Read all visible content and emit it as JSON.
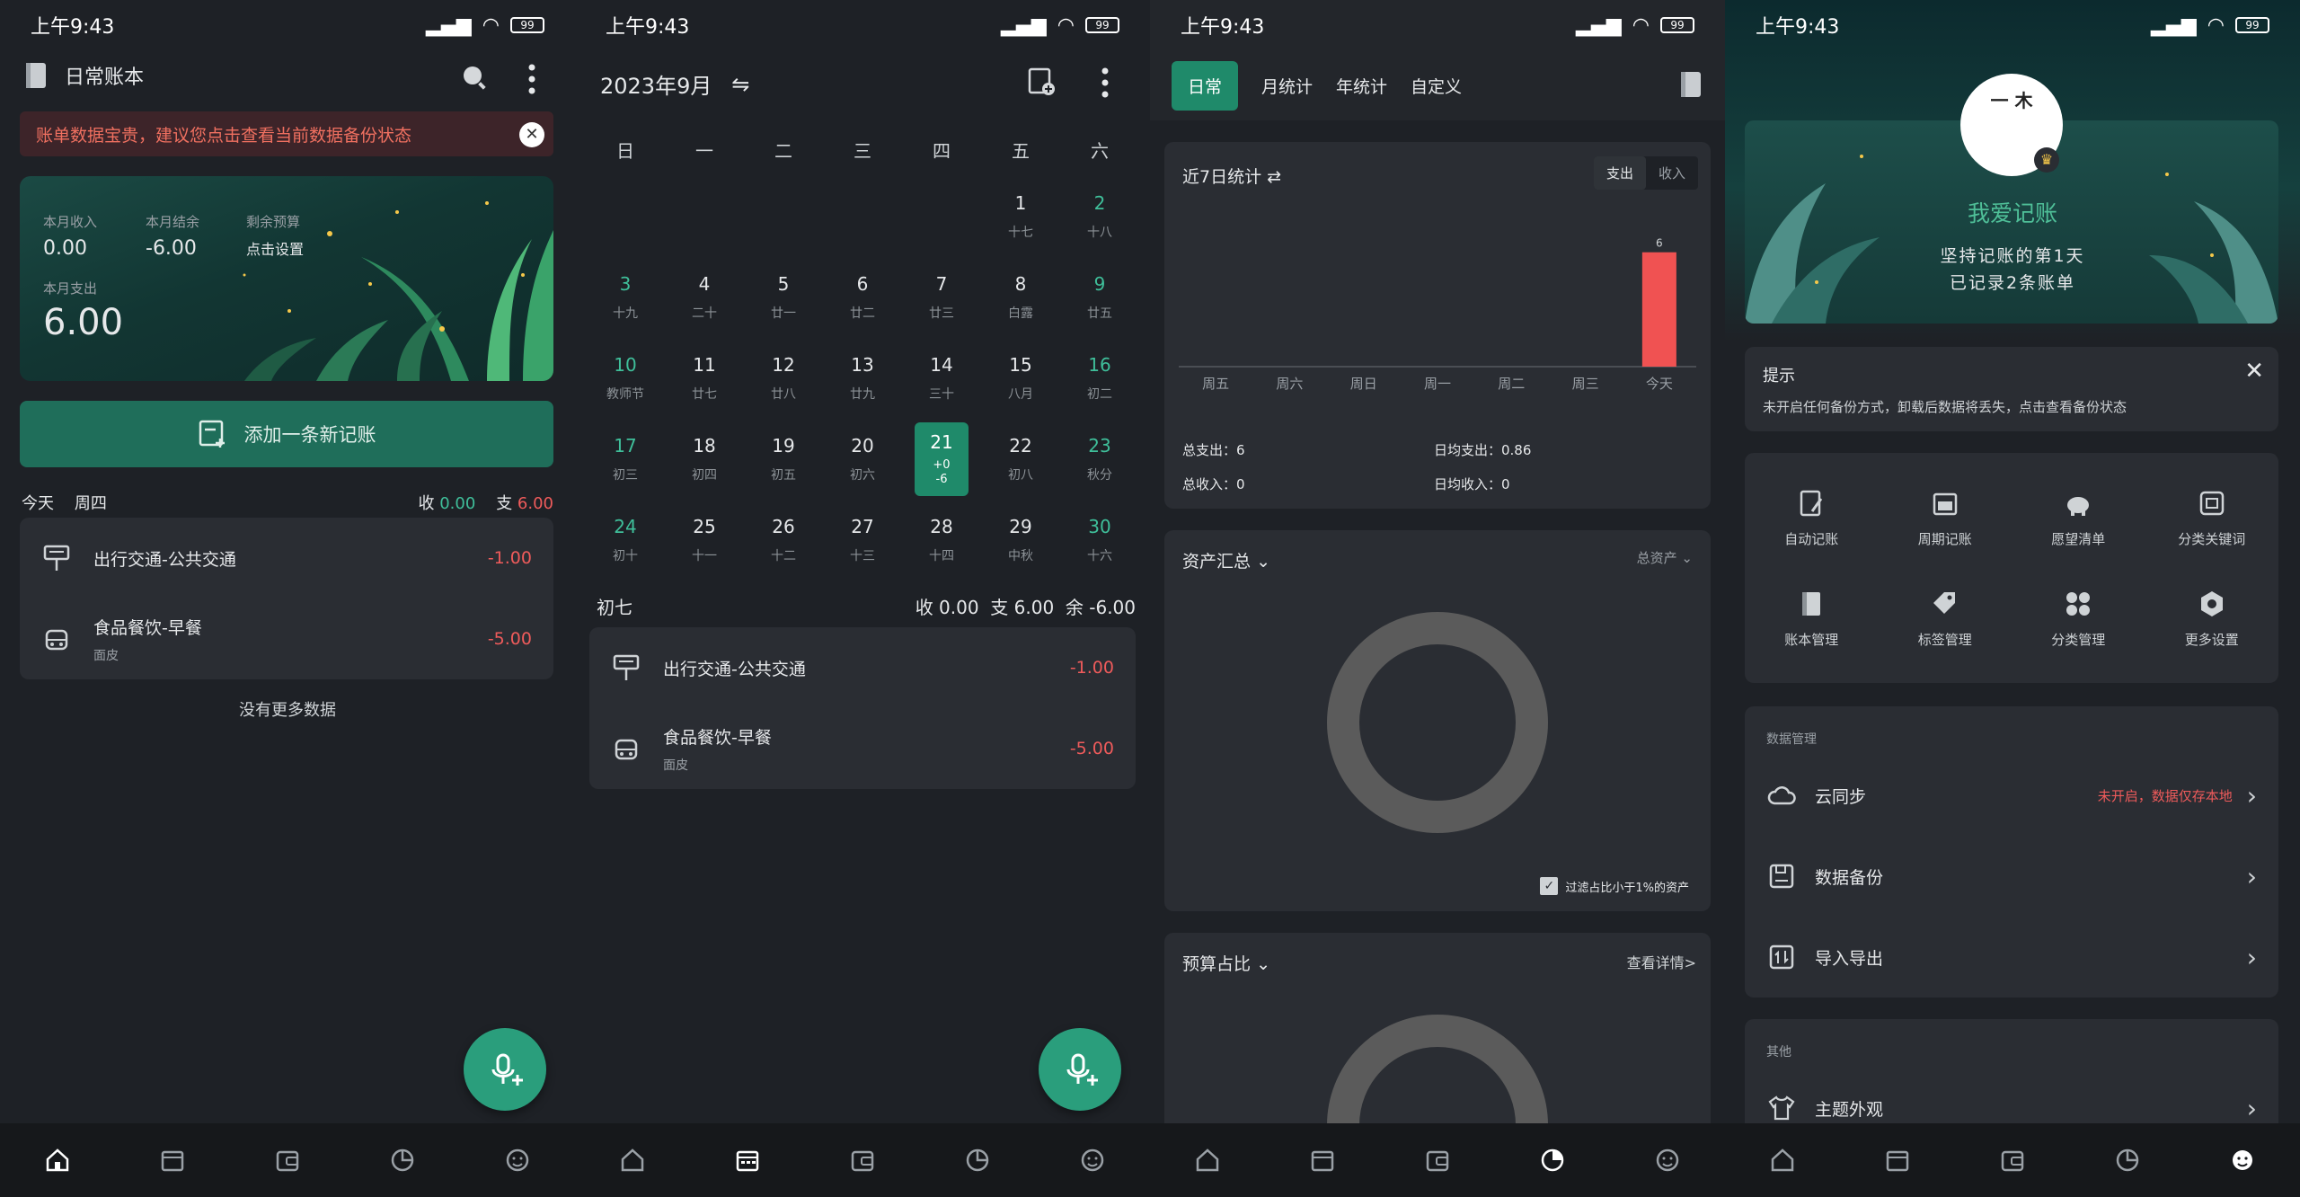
{
  "status": {
    "time": "上午9:43",
    "battery": "99"
  },
  "s1": {
    "book_title": "日常账本",
    "warning": "账单数据宝贵，建议您点击查看当前数据备份状态",
    "month_income_label": "本月收入",
    "month_income": "0.00",
    "month_balance_label": "本月结余",
    "month_balance": "-6.00",
    "budget_label": "剩余预算",
    "budget_value": "点击设置",
    "month_expense_label": "本月支出",
    "month_expense": "6.00",
    "add_button": "添加一条新记账",
    "day_label": "今天",
    "weekday": "周四",
    "income_prefix": "收",
    "income_value": "0.00",
    "expense_prefix": "支",
    "expense_value": "6.00",
    "no_more": "没有更多数据"
  },
  "entries": [
    {
      "name": "出行交通-公共交通",
      "sub": "",
      "amount": "-1.00",
      "icon": "bus-stop-icon"
    },
    {
      "name": "食品餐饮-早餐",
      "sub": "面皮",
      "amount": "-5.00",
      "icon": "food-icon"
    }
  ],
  "s2": {
    "month_title": "2023年9月",
    "weekdays": [
      "日",
      "一",
      "二",
      "三",
      "四",
      "五",
      "六"
    ],
    "lunar_day": "初七",
    "summary": "收 0.00  支 6.00  余 -6.00",
    "selected_income": "+0",
    "selected_expense": "-6"
  },
  "calendar": [
    {
      "d": "",
      "l": ""
    },
    {
      "d": "",
      "l": ""
    },
    {
      "d": "",
      "l": ""
    },
    {
      "d": "",
      "l": ""
    },
    {
      "d": "",
      "l": ""
    },
    {
      "d": "1",
      "l": "十七"
    },
    {
      "d": "2",
      "l": "十八"
    },
    {
      "d": "3",
      "l": "十九"
    },
    {
      "d": "4",
      "l": "二十"
    },
    {
      "d": "5",
      "l": "廿一"
    },
    {
      "d": "6",
      "l": "廿二"
    },
    {
      "d": "7",
      "l": "廿三"
    },
    {
      "d": "8",
      "l": "白露"
    },
    {
      "d": "9",
      "l": "廿五"
    },
    {
      "d": "10",
      "l": "教师节"
    },
    {
      "d": "11",
      "l": "廿七"
    },
    {
      "d": "12",
      "l": "廿八"
    },
    {
      "d": "13",
      "l": "廿九"
    },
    {
      "d": "14",
      "l": "三十"
    },
    {
      "d": "15",
      "l": "八月"
    },
    {
      "d": "16",
      "l": "初二"
    },
    {
      "d": "17",
      "l": "初三"
    },
    {
      "d": "18",
      "l": "初四"
    },
    {
      "d": "19",
      "l": "初五"
    },
    {
      "d": "20",
      "l": "初六"
    },
    {
      "d": "21",
      "l": "sel"
    },
    {
      "d": "22",
      "l": "初八"
    },
    {
      "d": "23",
      "l": "秋分"
    },
    {
      "d": "24",
      "l": "初十"
    },
    {
      "d": "25",
      "l": "十一"
    },
    {
      "d": "26",
      "l": "十二"
    },
    {
      "d": "27",
      "l": "十三"
    },
    {
      "d": "28",
      "l": "十四"
    },
    {
      "d": "29",
      "l": "中秋"
    },
    {
      "d": "30",
      "l": "十六"
    }
  ],
  "s3": {
    "tabs": [
      "日常",
      "月统计",
      "年统计",
      "自定义"
    ],
    "stat_title": "近7日统计",
    "toggle_expense": "支出",
    "toggle_income": "收入",
    "total_expense": "总支出：6",
    "avg_expense": "日均支出：0.86",
    "total_income": "总收入：0",
    "avg_income": "日均收入：0",
    "assets_title": "资产汇总",
    "assets_filter": "总资产",
    "assets_check": "过滤占比小于1%的资产",
    "budget_title": "预算占比",
    "budget_link": "查看详情>"
  },
  "chart_data": {
    "type": "bar",
    "categories": [
      "周五",
      "周六",
      "周日",
      "周一",
      "周二",
      "周三",
      "今天"
    ],
    "values": [
      0,
      0,
      0,
      0,
      0,
      0,
      6
    ],
    "data_labels": [
      "",
      "",
      "",
      "",
      "",
      "",
      "6"
    ],
    "ylim": [
      0,
      6.6
    ],
    "color": "#f05252"
  },
  "s4": {
    "app_name": "我爱记账",
    "avatar_text": "一 木",
    "days_line": "坚持记账的第1天",
    "records_line": "已记录2条账单",
    "tip_title": "提示",
    "tip_text": "未开启任何备份方式，卸载后数据将丢失，点击查看备份状态",
    "features": [
      {
        "label": "自动记账",
        "icon": "auto-record-icon"
      },
      {
        "label": "周期记账",
        "icon": "calendar-icon"
      },
      {
        "label": "愿望清单",
        "icon": "piggy-bank-icon"
      },
      {
        "label": "分类关键词",
        "icon": "keyword-icon"
      },
      {
        "label": "账本管理",
        "icon": "book-icon"
      },
      {
        "label": "标签管理",
        "icon": "tag-icon"
      },
      {
        "label": "分类管理",
        "icon": "category-icon"
      },
      {
        "label": "更多设置",
        "icon": "settings-icon"
      }
    ],
    "data_section": "数据管理",
    "cloud_sync": "云同步",
    "cloud_status": "未开启，数据仅存本地",
    "backup": "数据备份",
    "import_export": "导入导出",
    "other_section": "其他",
    "theme": "主题外观"
  },
  "colors": {
    "accent": "#1f8a6a",
    "expense": "#ef5b5b",
    "background": "#1e2126",
    "card": "#2a2d33"
  }
}
